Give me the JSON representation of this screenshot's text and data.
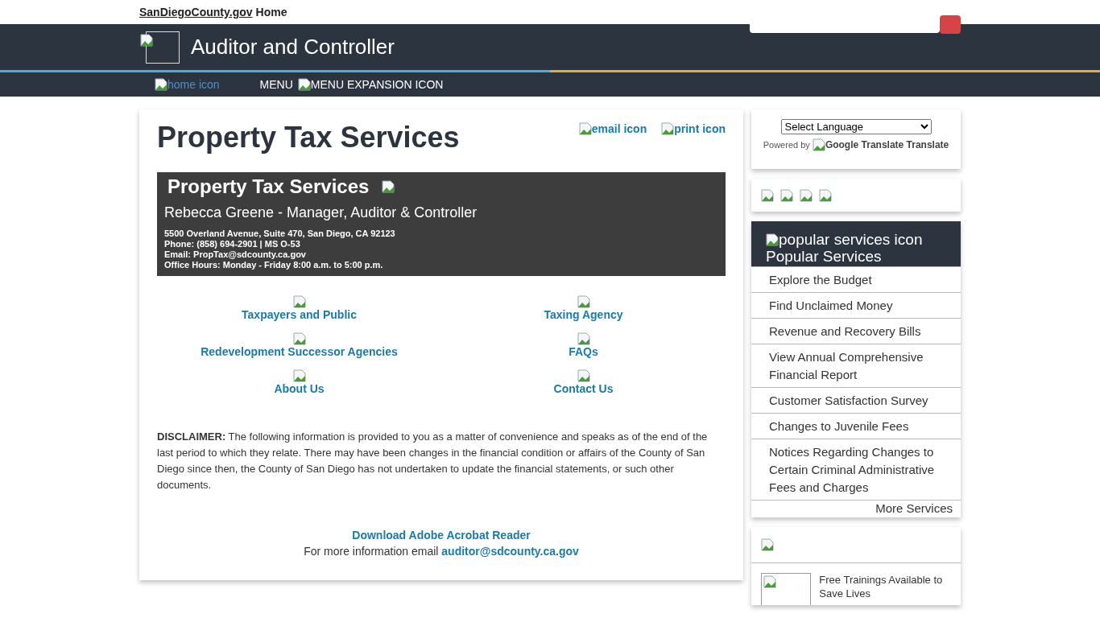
{
  "top_bar": {
    "site_link": "SanDiegoCounty.gov",
    "home_link": "Home"
  },
  "header": {
    "title": "Auditor and Controller"
  },
  "nav": {
    "home_alt": "home icon",
    "menu": "MENU",
    "menu_alt": "MENU EXPANSION ICON"
  },
  "page": {
    "title": "Property Tax Services",
    "email_alt": "email icon",
    "print_alt": "print icon",
    "banner": {
      "title": "Property Tax Services",
      "subtitle": "Rebecca Greene - Manager, Auditor & Controller",
      "lines": [
        "5500 Overland Avenue, Suite 470, San Diego, CA 92123",
        "Phone: (858) 694-2901 | MS O-53",
        "Email: PropTax@sdcounty.ca.gov",
        "Office Hours: Monday - Friday 8:00 a.m. to 5:00 p.m."
      ]
    },
    "links": [
      "Taxpayers and Public",
      "Taxing Agency",
      "Redevelopment Successor Agencies",
      "FAQs",
      "About Us",
      "Contact Us"
    ],
    "disclaimer": "**DISCLAIMER:** The following information is provided to you as a matter of convenience and speaks as of the end of the last period to which they relate. There may have been changes in the financial condition or affairs of the County of San Diego since then, the County of San Diego has not undertaken to update the financial statements, or such other documents.",
    "acrobat_link": "Download Adobe Acrobat Reader",
    "more_info": "For more information email",
    "email_link": "auditor@sdcounty.ca.gov"
  },
  "sidebar": {
    "language_select": "Select Language",
    "powered_by": "Powered by",
    "translate_alt": "Google Translate Translate",
    "popular": {
      "icon_alt": "popular services icon",
      "title": "Popular Services",
      "items": [
        "Explore the Budget",
        "Find Unclaimed Money",
        "Revenue and Recovery Bills",
        "View Annual Comprehensive Financial Report",
        "Customer Satisfaction Survey",
        "Changes to Juvenile Fees",
        "Notices Regarding Changes to Certain Criminal Administrative Fees and Charges"
      ],
      "more": "More Services"
    },
    "news": {
      "text": "Free Trainings Available to Save Lives"
    }
  }
}
